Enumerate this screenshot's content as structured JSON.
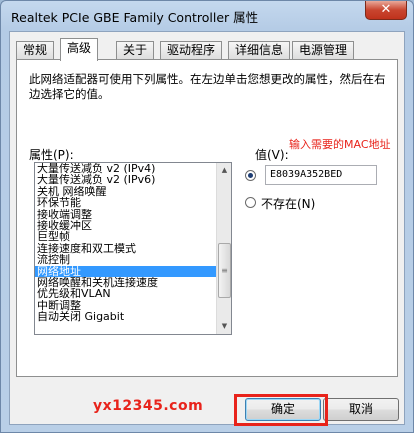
{
  "window": {
    "title": "Realtek PCIe GBE Family Controller 属性",
    "close_label": "✕"
  },
  "tabs": [
    {
      "label": "常规"
    },
    {
      "label": "高级"
    },
    {
      "label": "关于"
    },
    {
      "label": "驱动程序"
    },
    {
      "label": "详细信息"
    },
    {
      "label": "电源管理"
    }
  ],
  "active_tab": "高级",
  "description": "此网络适配器可使用下列属性。在左边单击您想更改的属性，然后在右边选择它的值。",
  "property_label": "属性(P):",
  "value_label": "值(V):",
  "annotation": "输入需要的MAC地址",
  "properties": [
    "大量传送减负 v2 (IPv4)",
    "大量传送减负 v2 (IPv6)",
    "关机 网络唤醒",
    "环保节能",
    "接收端调整",
    "接收缓冲区",
    "巨型帧",
    "连接速度和双工模式",
    "流控制",
    "网络地址",
    "网络唤醒和关机连接速度",
    "优先级和VLAN",
    "中断调整",
    "自动关闭 Gigabit"
  ],
  "selected_property": "网络地址",
  "value_input": "E8039A352BED",
  "not_exist_label": "不存在(N)",
  "watermark": "yx12345.com",
  "buttons": {
    "ok": "确定",
    "cancel": "取消"
  },
  "colors": {
    "selection": "#3399ff",
    "annotation": "#e8231b"
  },
  "icons": {
    "scroll_up": "scroll-up-arrow-icon",
    "scroll_down": "scroll-down-arrow-icon",
    "close": "close-icon"
  }
}
